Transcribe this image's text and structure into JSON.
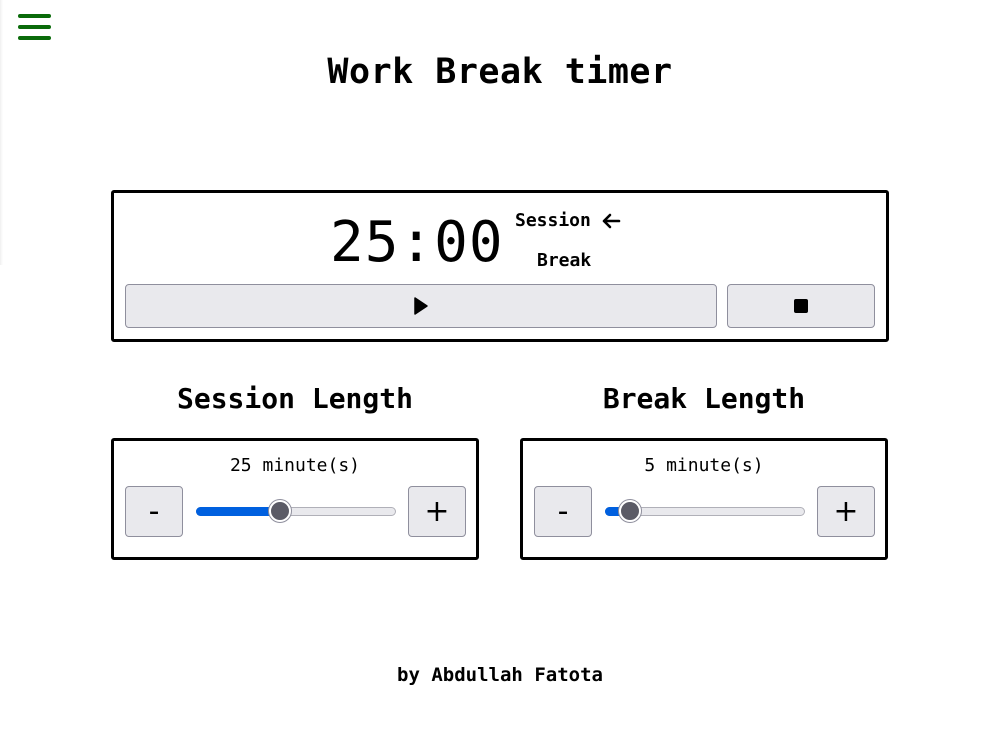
{
  "header": {
    "title": "Work Break timer",
    "menu_icon": "hamburger-menu-icon",
    "menu_color": "#0a6b0a"
  },
  "timer": {
    "time": "25:00",
    "mode_session_label": "Session",
    "mode_break_label": "Break",
    "active_mode": "Session",
    "active_indicator_icon": "left-arrow-icon",
    "play_icon": "play-icon",
    "stop_icon": "stop-icon"
  },
  "session": {
    "title": "Session Length",
    "value_text": "25 minute(s)",
    "minus_label": "-",
    "plus_label": "+",
    "slider_fraction": 0.42
  },
  "break": {
    "title": "Break Length",
    "value_text": "5 minute(s)",
    "minus_label": "-",
    "plus_label": "+",
    "slider_fraction": 0.12
  },
  "footer": {
    "credit": "by Abdullah Fatota"
  },
  "colors": {
    "slider_fill": "#0060df",
    "button_bg": "#e9e9ed",
    "border": "#000000"
  }
}
